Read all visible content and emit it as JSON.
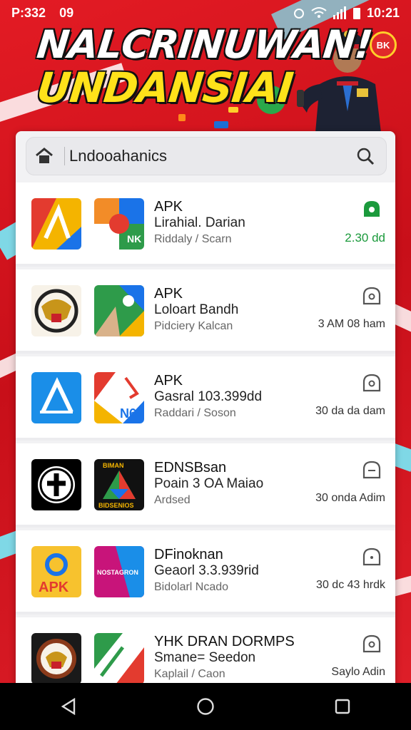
{
  "status": {
    "time": "P:332",
    "extra": "09",
    "clock": "10:21"
  },
  "banner": {
    "line1": "NALCRINUWAN!",
    "line2": "UNDANSIAI",
    "badge": "BK"
  },
  "search": {
    "query": "Lndooahanics",
    "icons": [
      "home-icon",
      "search-icon"
    ]
  },
  "apps": [
    {
      "title": "APK",
      "subtitle": "Lirahial. Darian",
      "detail": "Riddaly / Scarn",
      "meta": "2.30 dd",
      "meta_style": "green",
      "action_icon": "download-icon"
    },
    {
      "title": "APK",
      "subtitle": "Loloart Bandh",
      "detail": "Pidciery Kalcan",
      "meta": "3 AM 08 ham",
      "meta_style": "normal",
      "action_icon": "chat-icon"
    },
    {
      "title": "APK",
      "subtitle": "Gasral 103.399dd",
      "detail": "Raddari / Soson",
      "meta": "30 da da dam",
      "meta_style": "normal",
      "action_icon": "chat-icon"
    },
    {
      "title": "EDNSBsan",
      "subtitle": "Poain 3 OA Maiao",
      "detail": "Ardsed",
      "meta": "30 onda Adim",
      "meta_style": "normal",
      "action_icon": "chat-icon"
    },
    {
      "title": "DFinoknan",
      "subtitle": "Geaorl 3.3.939rid",
      "detail": "Bidolarl Ncado",
      "meta": "30 dc 43 hrdk",
      "meta_style": "normal",
      "action_icon": "chat-icon"
    },
    {
      "title": "YHK DRAN DORMPS",
      "subtitle": "Smane= Seedon",
      "detail": "Kaplail / Caon",
      "meta": "Saylo Adin",
      "meta_style": "normal",
      "action_icon": "chat-icon"
    }
  ],
  "nav": [
    "back-icon",
    "home-circle-icon",
    "recents-icon"
  ],
  "colors": {
    "accent_red": "#d8141f",
    "headline_yellow": "#ffe21a",
    "green": "#1b9a3c"
  }
}
